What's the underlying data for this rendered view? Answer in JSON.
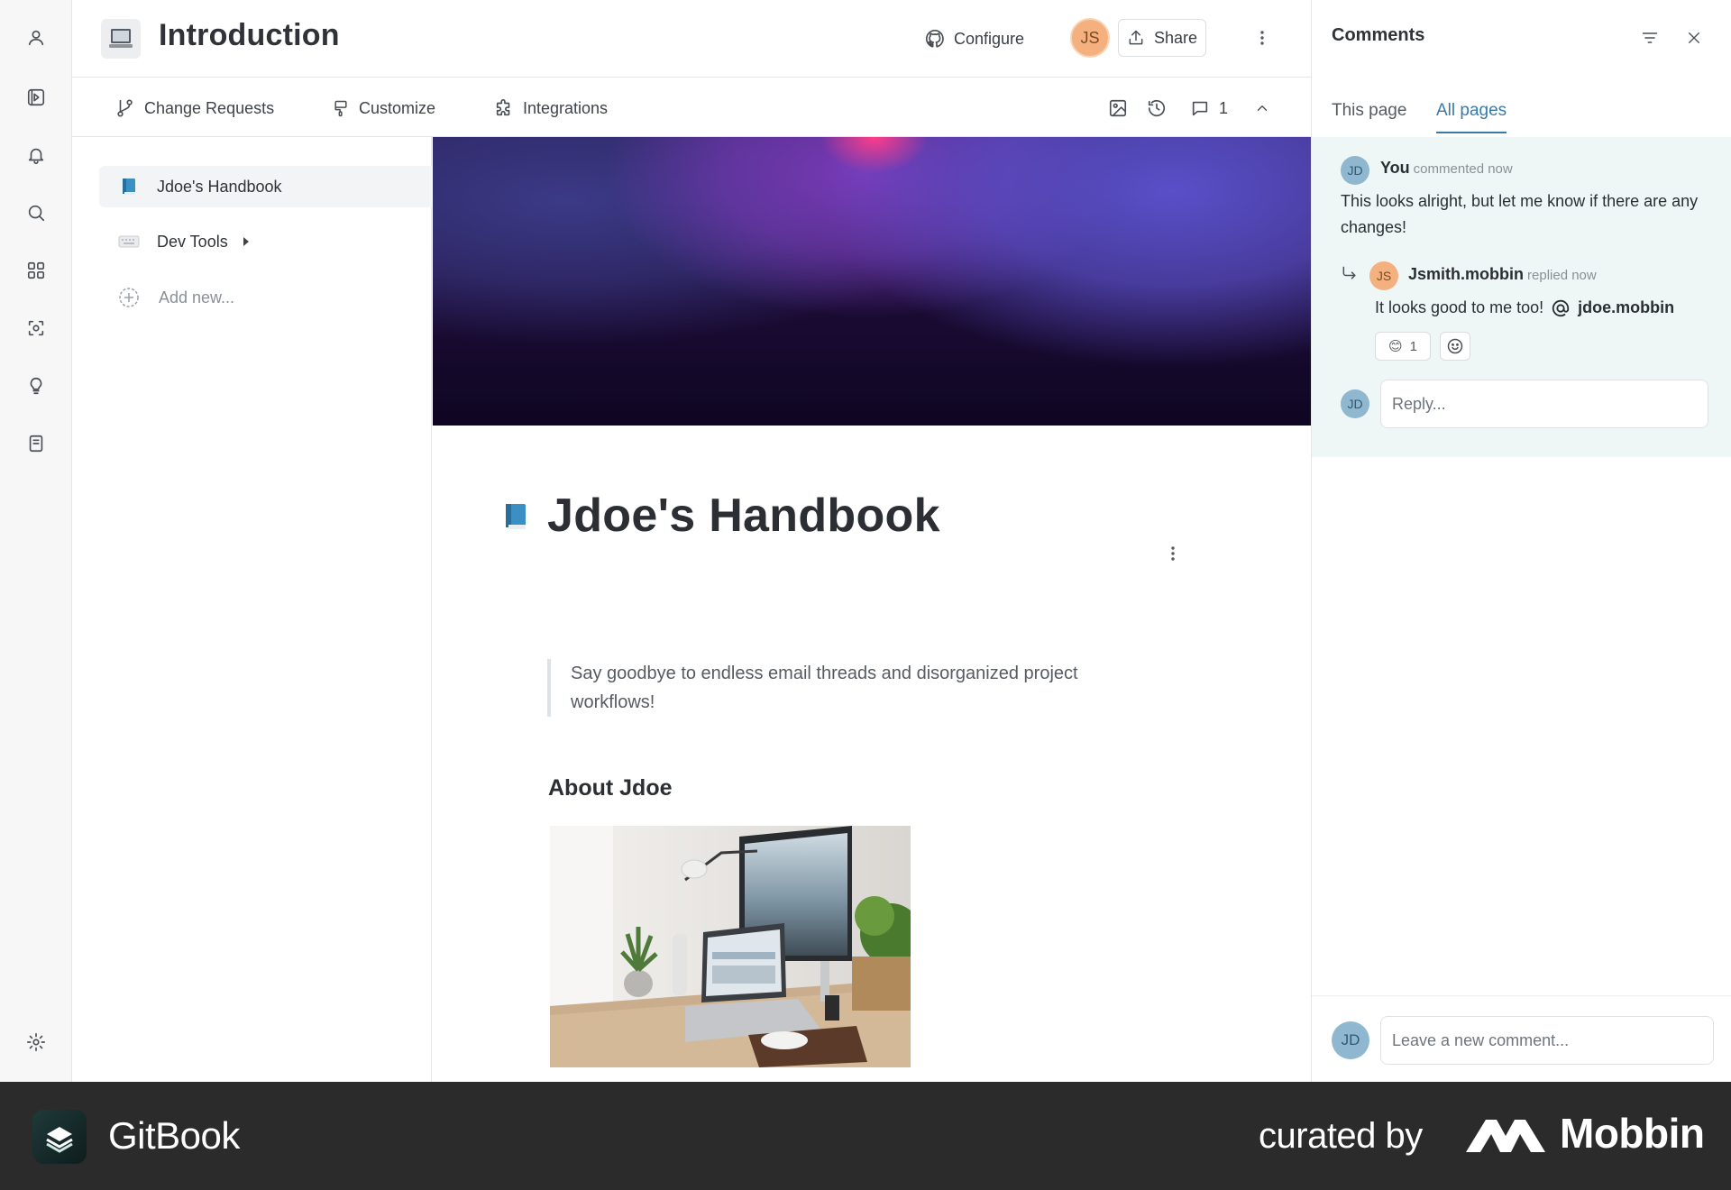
{
  "header": {
    "title": "Introduction",
    "configure_label": "Configure",
    "avatar_initials": "JS",
    "share_label": "Share"
  },
  "toolbar": {
    "change_requests_label": "Change Requests",
    "customize_label": "Customize",
    "integrations_label": "Integrations",
    "comment_count": "1"
  },
  "nav": {
    "items": [
      {
        "label": "Jdoe's Handbook",
        "icon": "blue-book-icon",
        "active": true
      },
      {
        "label": "Dev Tools",
        "icon": "keyboard-icon",
        "expandable": true
      },
      {
        "label": "Add new...",
        "icon": "add-circle-icon"
      }
    ]
  },
  "doc": {
    "title": "Jdoe's Handbook",
    "quote": "Say goodbye to endless email threads and disorganized project workflows!",
    "heading": "About Jdoe"
  },
  "comments": {
    "title": "Comments",
    "tabs": [
      {
        "label": "This page",
        "active": false
      },
      {
        "label": "All pages",
        "active": true
      }
    ],
    "thread": {
      "author_initials": "JD",
      "author": "You",
      "meta": "commented now",
      "body": "This looks alright, but let me know if there are any changes!",
      "reply": {
        "author_initials": "JS",
        "author": "Jsmith.mobbin",
        "meta": "replied now",
        "body": "It looks good to me too!",
        "mention": "jdoe.mobbin",
        "reaction_emoji": "😊",
        "reaction_count": "1"
      },
      "reply_avatar_initials": "JD",
      "reply_placeholder": "Reply..."
    },
    "new_comment": {
      "avatar_initials": "JD",
      "placeholder": "Leave a new comment..."
    }
  },
  "footer": {
    "brand": "GitBook",
    "curated_label": "curated by",
    "curator": "Mobbin"
  },
  "colors": {
    "accent": "#3a7aa8",
    "thread_bg": "#eef6f6",
    "footer_bg": "#2b2b2b",
    "avatar_js": "#f4b07e",
    "avatar_jd": "#8fb7cf"
  }
}
